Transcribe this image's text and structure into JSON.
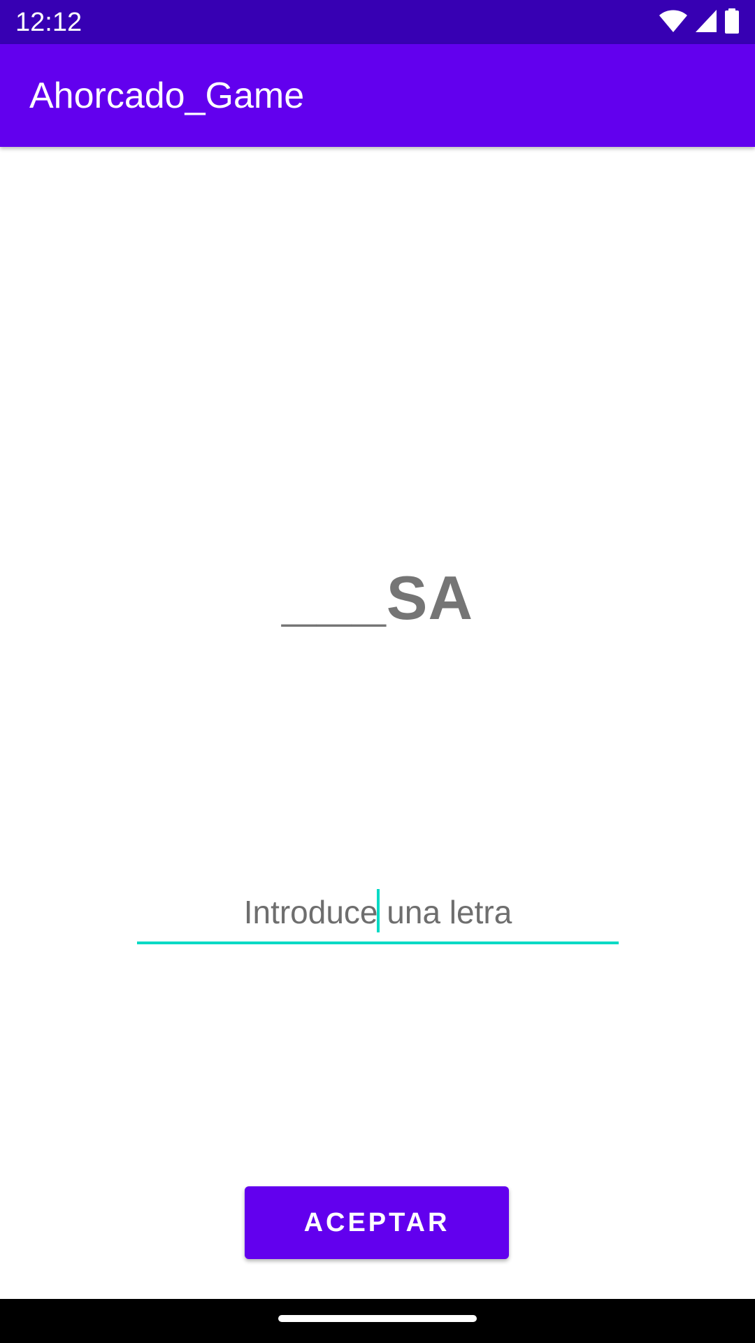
{
  "status_bar": {
    "time": "12:12",
    "icons": [
      "wifi-icon",
      "cellular-signal-icon",
      "battery-icon"
    ]
  },
  "app_bar": {
    "title": "Ahorcado_Game"
  },
  "game": {
    "word_display": "___SA"
  },
  "input": {
    "placeholder": "Introduce una letra",
    "value": ""
  },
  "actions": {
    "accept_label": "ACEPTAR"
  },
  "colors": {
    "primary": "#6200ee",
    "primary_dark": "#3700b3",
    "accent": "#03dac5",
    "word_text": "#757575"
  }
}
